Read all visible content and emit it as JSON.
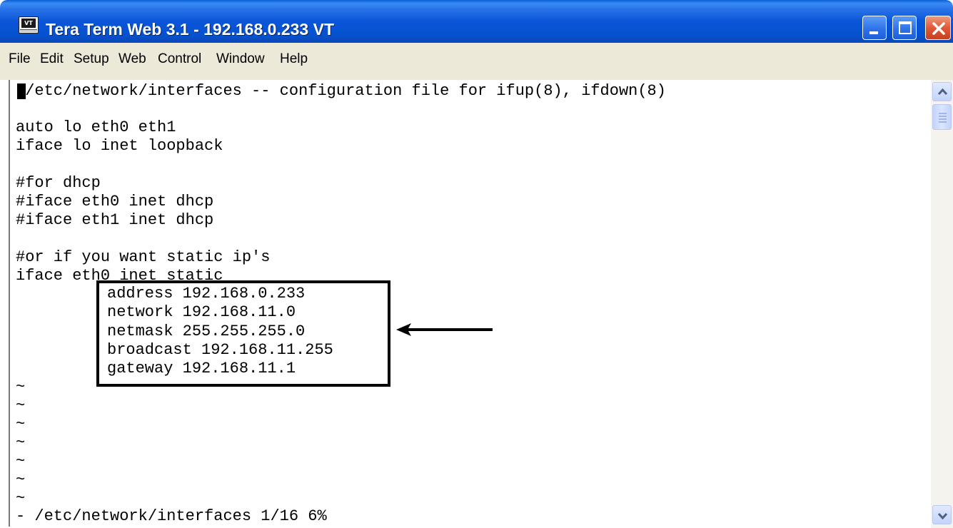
{
  "window": {
    "title": "Tera Term Web 3.1 - 192.168.0.233 VT",
    "app_icon_text": "VT",
    "title_color": "#0a55d8",
    "close_color": "#e05a38"
  },
  "menu": {
    "items": [
      "File",
      "Edit",
      "Setup",
      "Web",
      "Control",
      "Window",
      "Help"
    ]
  },
  "terminal": {
    "lines": [
      " /etc/network/interfaces -- configuration file for ifup(8), ifdown(8)",
      "",
      "auto lo eth0 eth1",
      "iface lo inet loopback",
      "",
      "#for dhcp",
      "#iface eth0 inet dhcp",
      "#iface eth1 inet dhcp",
      "",
      "#or if you want static ip's",
      "iface eth0 inet static"
    ],
    "highlighted_lines": [
      "address 192.168.0.233",
      "network 192.168.11.0",
      "netmask 255.255.255.0",
      "broadcast 192.168.11.255",
      "gateway 192.168.11.1"
    ],
    "tildes": [
      "~",
      "~",
      "~",
      "~",
      "~",
      "~",
      "~"
    ],
    "status_line": "- /etc/network/interfaces 1/16 6%"
  },
  "icons": {
    "app": "terminal-app-icon",
    "minimize": "minimize-icon",
    "maximize": "maximize-icon",
    "close": "close-icon",
    "scroll_up": "chevron-up-icon",
    "scroll_down": "chevron-down-icon",
    "annotation": "arrow-left-icon"
  }
}
